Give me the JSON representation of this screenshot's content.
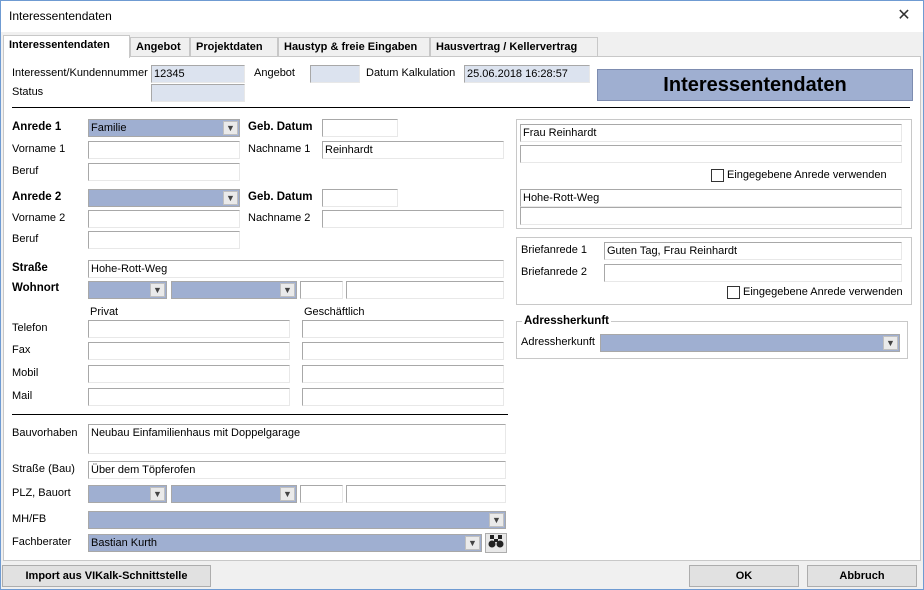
{
  "window": {
    "title": "Interessentendaten",
    "close_glyph": "✕"
  },
  "tabs": [
    {
      "label": "Interessentendaten",
      "active": true
    },
    {
      "label": "Angebot"
    },
    {
      "label": "Projektdaten"
    },
    {
      "label": "Haustyp & freie Eingaben"
    },
    {
      "label": "Hausvertrag / Kellervertrag"
    }
  ],
  "header": {
    "kundennummer_label": "Interessent/Kundennummer",
    "kundennummer_value": "12345",
    "angebot_label": "Angebot",
    "angebot_value": "",
    "kalkulation_label": "Datum Kalkulation",
    "kalkulation_value": "25.06.2018 16:28:57",
    "status_label": "Status",
    "status_value": "",
    "banner": "Interessentendaten"
  },
  "person1": {
    "anrede_label": "Anrede 1",
    "anrede_value": "Familie",
    "vorname_label": "Vorname 1",
    "vorname_value": "",
    "beruf_label": "Beruf",
    "beruf_value": "",
    "geb_label": "Geb. Datum",
    "geb_value": "",
    "nachname_label": "Nachname 1",
    "nachname_value": "Reinhardt"
  },
  "person2": {
    "anrede_label": "Anrede 2",
    "anrede_value": "",
    "vorname_label": "Vorname 2",
    "vorname_value": "",
    "beruf_label": "Beruf",
    "beruf_value": "",
    "geb_label": "Geb. Datum",
    "geb_value": "",
    "nachname_label": "Nachname 2",
    "nachname_value": ""
  },
  "address": {
    "strasse_label": "Straße",
    "strasse_value": "Hohe-Rott-Weg",
    "wohnort_label": "Wohnort"
  },
  "contact": {
    "privat_label": "Privat",
    "geschaeftlich_label": "Geschäftlich",
    "rows": [
      {
        "label": "Telefon"
      },
      {
        "label": "Fax"
      },
      {
        "label": "Mobil"
      },
      {
        "label": "Mail"
      }
    ]
  },
  "bau": {
    "vorhaben_label": "Bauvorhaben",
    "vorhaben_value": "Neubau Einfamilienhaus mit Doppelgarage",
    "strasse_label": "Straße (Bau)",
    "strasse_value": "Über dem Töpferofen",
    "plz_label": "PLZ, Bauort",
    "mhfb_label": "MH/FB",
    "mhfb_value": "",
    "fachberater_label": "Fachberater",
    "fachberater_value": "Bastian Kurth"
  },
  "right": {
    "anrede_line1": "Frau Reinhardt",
    "anrede_line2": "",
    "use_anrede_label": "Eingegebene Anrede verwenden",
    "adresse_line1": "Hohe-Rott-Weg",
    "adresse_line2": "",
    "brief1_label": "Briefanrede 1",
    "brief1_value": "Guten Tag, Frau Reinhardt",
    "brief2_label": "Briefanrede 2",
    "brief2_value": "",
    "use_brief_label": "Eingegebene Anrede verwenden",
    "herkunft_title": "Adressherkunft",
    "herkunft_label": "Adressherkunft",
    "herkunft_value": ""
  },
  "footer": {
    "import_label": "Import aus VIKalk-Schnittstelle",
    "ok_label": "OK",
    "cancel_label": "Abbruch"
  },
  "colors": {
    "accent": "#9fafd1",
    "readonly": "#dce3ef"
  }
}
